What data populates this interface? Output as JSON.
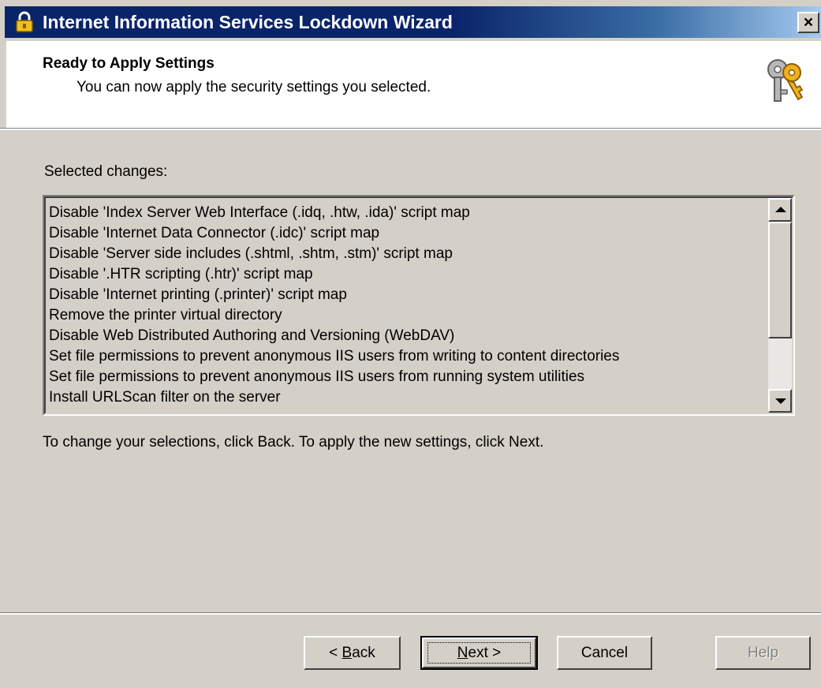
{
  "window": {
    "title": "Internet Information Services Lockdown Wizard",
    "title_icon": "lock-icon",
    "close_label": "×"
  },
  "header": {
    "title": "Ready to Apply Settings",
    "subtitle": "You can now apply the security settings you selected.",
    "icon": "keys-icon"
  },
  "main": {
    "list_label": "Selected changes:",
    "changes": [
      "Disable 'Index Server Web Interface (.idq, .htw, .ida)' script map",
      "Disable 'Internet Data Connector (.idc)' script map",
      "Disable 'Server side includes (.shtml, .shtm, .stm)' script map",
      "Disable '.HTR scripting (.htr)' script map",
      "Disable 'Internet printing (.printer)' script map",
      "Remove the printer virtual directory",
      "Disable Web Distributed Authoring and Versioning (WebDAV)",
      "Set file permissions to prevent anonymous IIS users from writing to content directories",
      "Set file permissions to prevent anonymous IIS users from running system utilities",
      "Install URLScan filter on the server"
    ],
    "instruction": "To change your selections, click Back. To apply the new settings, click Next."
  },
  "buttons": {
    "back_prefix": "< ",
    "back_key": "B",
    "back_rest": "ack",
    "next_key": "N",
    "next_rest": "ext >",
    "cancel": "Cancel",
    "help": "Help"
  },
  "colors": {
    "title_bar": "#0a246a",
    "dialog_face": "#d4d0c8",
    "header_bg": "#ffffff"
  }
}
